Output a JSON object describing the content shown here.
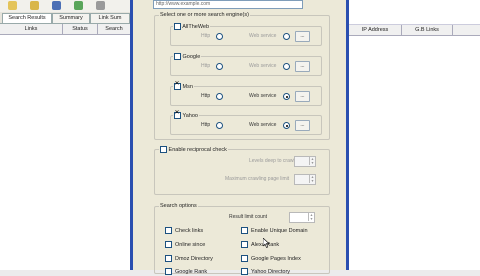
{
  "url_value": "http://www.example.com",
  "tabs": [
    "Search Results",
    "Summary",
    "Link Sum"
  ],
  "left_columns": [
    "Links",
    "Status",
    "Search"
  ],
  "right_columns": [
    "IP Address",
    "G.B Links"
  ],
  "engines_group_label": "Select one or more search engine(s)",
  "engines": [
    {
      "name": "AllTheWeb",
      "checked": false,
      "http_label": "Http",
      "web_label": "Web service",
      "selected": "none"
    },
    {
      "name": "Google",
      "checked": false,
      "http_label": "Http",
      "web_label": "Web service",
      "selected": "none"
    },
    {
      "name": "Msn",
      "checked": true,
      "http_label": "Http",
      "web_label": "Web service",
      "selected": "web"
    },
    {
      "name": "Yahoo",
      "checked": true,
      "http_label": "Http",
      "web_label": "Web service",
      "selected": "web"
    }
  ],
  "browse_label": "...",
  "reciprocal": {
    "label": "Enable reciprocal check",
    "depth_label": "Levels deep to crawl",
    "max_pages_label": "Maximum crawling page limit"
  },
  "search_options": {
    "label": "Search options",
    "result_limit_label": "Result limit count",
    "options": [
      "Check links",
      "Enable Unique Domain",
      "Online since",
      "Alexa Rank",
      "Dmoz Directory",
      "Google Pages Index",
      "Google Rank",
      "Yahoo Directory"
    ]
  },
  "colors": {
    "dialog_bg": "#ece9d8",
    "dialog_border": "#2a4fb0"
  }
}
